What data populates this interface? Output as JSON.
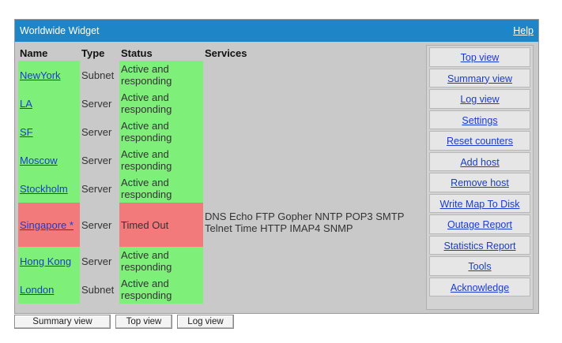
{
  "window": {
    "title": "Worldwide Widget",
    "help_label": "Help"
  },
  "table": {
    "headers": [
      "Name",
      "Type",
      "Status",
      "Services"
    ],
    "rows": [
      {
        "name": "NewYork",
        "type": "Subnet",
        "status": "Active and responding",
        "status_color": "#7ef07a",
        "services": ""
      },
      {
        "name": "LA",
        "type": "Server",
        "status": "Active and responding",
        "status_color": "#7ef07a",
        "services": ""
      },
      {
        "name": "SF",
        "type": "Server",
        "status": "Active and responding",
        "status_color": "#7ef07a",
        "services": ""
      },
      {
        "name": "Moscow",
        "type": "Server",
        "status": "Active and responding",
        "status_color": "#7ef07a",
        "services": ""
      },
      {
        "name": "Stockholm",
        "type": "Server",
        "status": "Active and responding",
        "status_color": "#7ef07a",
        "services": ""
      },
      {
        "name": "Singapore *",
        "type": "Server",
        "status": "Timed Out",
        "status_color": "#f27a7a",
        "services": "DNS Echo FTP Gopher NNTP POP3 SMTP Telnet Time HTTP IMAP4 SNMP"
      },
      {
        "name": "Hong Kong",
        "type": "Server",
        "status": "Active and responding",
        "status_color": "#7ef07a",
        "services": ""
      },
      {
        "name": "London",
        "type": "Subnet",
        "status": "Active and responding",
        "status_color": "#7ef07a",
        "services": ""
      }
    ]
  },
  "side_nav": [
    "Top view",
    "Summary view",
    "Log view",
    "Settings",
    "Reset counters",
    "Add host",
    "Remove host",
    "Write Map To Disk",
    "Outage Report",
    "Statistics Report",
    "Tools",
    "Acknowledge"
  ],
  "bottom_buttons": [
    "Summary view",
    "Top view",
    "Log view"
  ],
  "colors": {
    "titlebar": "#1e86c6",
    "ok": "#7ef07a",
    "error": "#f27a7a",
    "link": "#1a3bd0"
  }
}
